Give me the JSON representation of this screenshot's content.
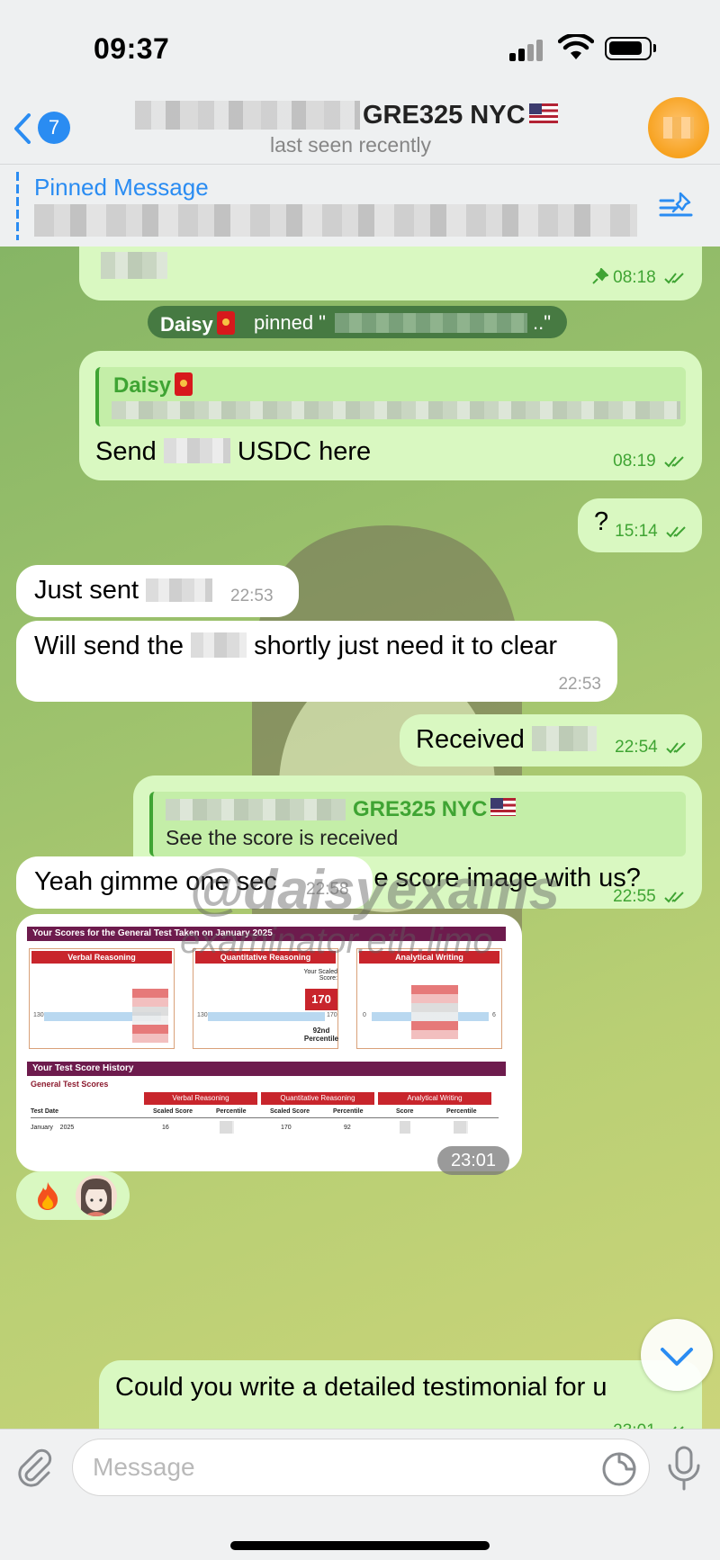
{
  "status_bar": {
    "time": "09:37"
  },
  "header": {
    "back_badge": "7",
    "contact_name": "GRE325 NYC",
    "subtitle": "last seen recently"
  },
  "pinned": {
    "label": "Pinned Message"
  },
  "messages": {
    "m1_time": "08:18",
    "service_author": "Daisy",
    "service_action": "pinned \"",
    "service_tail": "..\"",
    "m2_reply_author": "Daisy",
    "m2_text_a": "Send",
    "m2_text_b": "USDC here",
    "m2_time": "08:19",
    "m3_text": "?",
    "m3_time": "15:14",
    "m4_text": "Just sent",
    "m4_time": "22:53",
    "m5_text_a": "Will send the",
    "m5_text_b": "shortly just need it to clear",
    "m5_time": "22:53",
    "m6_text": "Received",
    "m6_time": "22:54",
    "m7_reply_author": "GRE325 NYC",
    "m7_reply_text": "See the score is received",
    "m7_text": "Would you share the score image with us?",
    "m7_time": "22:55",
    "m8_text": "Yeah gimme one sec",
    "m8_time": "22:58",
    "img_time": "23:01",
    "m9_text": "Could you write a detailed testimonial for u",
    "m9_time": "23:01"
  },
  "score_report": {
    "title": "Your Scores for the General Test Taken on January    2025",
    "sections": [
      "Verbal Reasoning",
      "Quantitative Reasoning",
      "Analytical Writing"
    ],
    "scaled_label": "Your Scaled Score:",
    "quant_score": "170",
    "quant_percentile": "92nd",
    "percentile_word": "Percentile",
    "tick_130a": "130",
    "tick_130b": "130",
    "tick_170": "170",
    "tick_0": "0",
    "tick_6": "6",
    "history_title": "Your Test Score History",
    "general_label": "General Test Scores",
    "col_test_date": "Test Date",
    "col_scaled": "Scaled Score",
    "col_percentile": "Percentile",
    "col_score": "Score",
    "row_date": "January    2025",
    "row_verbal": "16",
    "row_quant": "170",
    "row_quant_pct": "92"
  },
  "watermark": {
    "handle": "@daisyexams",
    "site": "examinator.eth.limo"
  },
  "composer": {
    "placeholder": "Message"
  },
  "colors": {
    "accent": "#2a8cf2",
    "outgoing_bubble": "#d9f8c1",
    "incoming_bubble": "#ffffff",
    "meta_green": "#3fa433",
    "report_maroon": "#6d1b4d",
    "report_red": "#c8252c"
  },
  "icons": [
    "back-chevron-icon",
    "signal-icon",
    "wifi-icon",
    "battery-icon",
    "pin-list-icon",
    "pin-icon",
    "double-check-icon",
    "fire-emoji-icon",
    "scroll-down-chevron-icon",
    "attach-paperclip-icon",
    "sticker-icon",
    "microphone-icon"
  ]
}
